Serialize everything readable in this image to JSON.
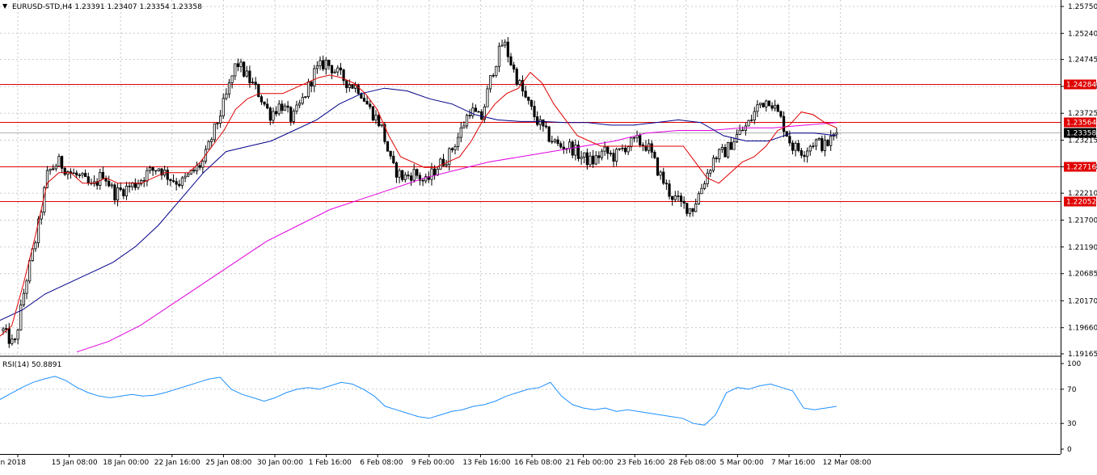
{
  "header": {
    "symbol_line": "EURUSD-STD,H4  1.23391 1.23407 1.23354 1.23358",
    "menu_icon": "triangle-down-icon"
  },
  "rsi_header": {
    "label": "RSI(14) 50.8891"
  },
  "colors": {
    "candle": "#000000",
    "ma_fast": "#e00000",
    "ma_mid": "#00008b",
    "ma_slow": "#e000e0",
    "hline": "#e00000",
    "rsi": "#1e90ff",
    "grid": "#c8c8c8",
    "price_label_bg": "#e00000",
    "current_label_bg": "#000000"
  },
  "price_axis": {
    "ticks": [
      "1.25750",
      "1.25240",
      "1.24745",
      "1.24235",
      "1.23725",
      "1.23215",
      "1.22710",
      "1.22210",
      "1.21700",
      "1.21190",
      "1.20685",
      "1.20170",
      "1.19660",
      "1.19165"
    ]
  },
  "rsi_axis": {
    "ticks": [
      "100",
      "70",
      "30",
      "0"
    ]
  },
  "time_axis": {
    "ticks": [
      "10 Jan 2018",
      "15 Jan 08:00",
      "18 Jan 00:00",
      "22 Jan 16:00",
      "25 Jan 08:00",
      "30 Jan 00:00",
      "1 Feb 16:00",
      "6 Feb 08:00",
      "9 Feb 00:00",
      "13 Feb 16:00",
      "16 Feb 08:00",
      "21 Feb 00:00",
      "23 Feb 16:00",
      "28 Feb 08:00",
      "5 Mar 00:00",
      "7 Mar 16:00",
      "12 Mar 08:00"
    ]
  },
  "levels": [
    {
      "price": 1.24284,
      "label": "1.24284"
    },
    {
      "price": 1.23564,
      "label": "1.23564"
    },
    {
      "price": 1.22716,
      "label": "1.22716"
    },
    {
      "price": 1.22052,
      "label": "1.22052"
    }
  ],
  "current_price": {
    "price": 1.23358,
    "label": "1.23358"
  },
  "chart_data": {
    "type": "candlestick",
    "symbol": "EURUSD-STD",
    "timeframe": "H4",
    "ylim": [
      1.19165,
      1.2575
    ],
    "anchors": [
      1.196,
      1.193,
      1.205,
      1.214,
      1.226,
      1.228,
      1.226,
      1.225,
      1.223,
      1.226,
      1.222,
      1.223,
      1.224,
      1.226,
      1.227,
      1.225,
      1.224,
      1.226,
      1.228,
      1.234,
      1.24,
      1.247,
      1.244,
      1.241,
      1.237,
      1.239,
      1.236,
      1.24,
      1.245,
      1.247,
      1.245,
      1.243,
      1.242,
      1.238,
      1.235,
      1.227,
      1.225,
      1.226,
      1.224,
      1.227,
      1.229,
      1.233,
      1.238,
      1.236,
      1.245,
      1.251,
      1.245,
      1.24,
      1.236,
      1.233,
      1.231,
      1.231,
      1.229,
      1.228,
      1.23,
      1.229,
      1.231,
      1.232,
      1.231,
      1.226,
      1.222,
      1.22,
      1.219,
      1.224,
      1.229,
      1.23,
      1.233,
      1.235,
      1.239,
      1.24,
      1.236,
      1.231,
      1.23,
      1.232,
      1.231,
      1.2336
    ],
    "ma_fast": [
      1.195,
      1.197,
      1.205,
      1.214,
      1.224,
      1.226,
      1.226,
      1.224,
      1.224,
      1.225,
      1.224,
      1.224,
      1.224,
      1.225,
      1.226,
      1.226,
      1.226,
      1.228,
      1.231,
      1.234,
      1.238,
      1.24,
      1.241,
      1.241,
      1.241,
      1.242,
      1.243,
      1.244,
      1.2445,
      1.244,
      1.243,
      1.241,
      1.238,
      1.233,
      1.229,
      1.228,
      1.227,
      1.227,
      1.228,
      1.229,
      1.232,
      1.236,
      1.239,
      1.241,
      1.242,
      1.245,
      1.243,
      1.239,
      1.236,
      1.233,
      1.232,
      1.231,
      1.231,
      1.231,
      1.231,
      1.231,
      1.231,
      1.231,
      1.231,
      1.228,
      1.225,
      1.224,
      1.226,
      1.228,
      1.229,
      1.231,
      1.234,
      1.235,
      1.2375,
      1.237,
      1.2355,
      1.2345
    ],
    "ma_mid": [
      1.198,
      1.2,
      1.203,
      1.205,
      1.207,
      1.209,
      1.212,
      1.216,
      1.221,
      1.226,
      1.23,
      1.231,
      1.232,
      1.234,
      1.236,
      1.239,
      1.241,
      1.242,
      1.2415,
      1.24,
      1.239,
      1.237,
      1.236,
      1.2357,
      1.2357,
      1.2355,
      1.2355,
      1.235,
      1.235,
      1.2355,
      1.236,
      1.2355,
      1.233,
      1.232,
      1.232,
      1.2335,
      1.2335,
      1.233
    ],
    "ma_slow": [
      1.192,
      1.194,
      1.197,
      1.201,
      1.205,
      1.209,
      1.213,
      1.216,
      1.219,
      1.221,
      1.223,
      1.225,
      1.2265,
      1.228,
      1.229,
      1.23,
      1.231,
      1.232,
      1.2335,
      1.234,
      1.234,
      1.2345,
      1.2345,
      1.235,
      1.2355
    ],
    "rsi": [
      58,
      65,
      72,
      78,
      82,
      85,
      80,
      72,
      66,
      62,
      60,
      62,
      64,
      62,
      63,
      66,
      70,
      74,
      78,
      82,
      84,
      70,
      64,
      60,
      56,
      60,
      66,
      70,
      72,
      70,
      74,
      78,
      76,
      70,
      62,
      50,
      46,
      42,
      38,
      36,
      40,
      44,
      46,
      50,
      52,
      56,
      62,
      66,
      70,
      72,
      78,
      62,
      52,
      48,
      46,
      48,
      44,
      46,
      44,
      42,
      40,
      38,
      36,
      30,
      28,
      40,
      66,
      72,
      70,
      74,
      76,
      72,
      68,
      48,
      46,
      48,
      50
    ],
    "rsi_ylim": [
      0,
      100
    ]
  }
}
